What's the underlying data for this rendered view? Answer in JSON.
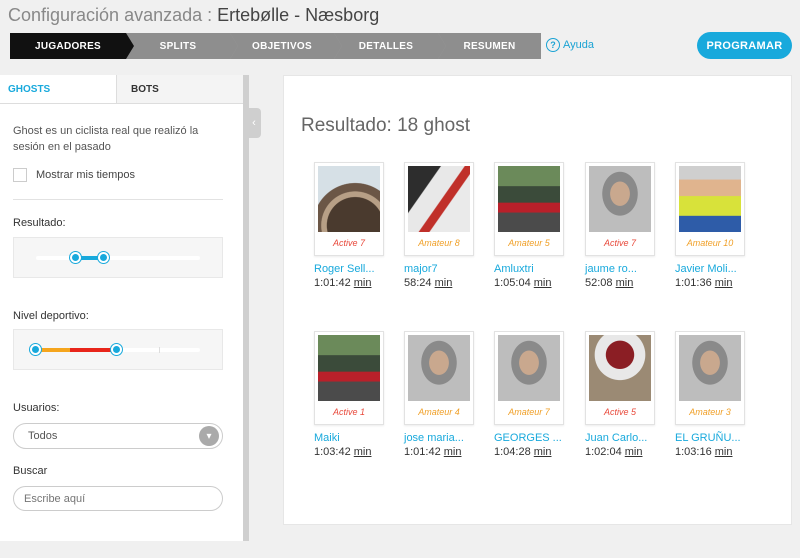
{
  "header": {
    "title_prefix": "Configuración avanzada :",
    "title_route": "Ertebølle - Næsborg"
  },
  "steps": [
    "JUGADORES",
    "SPLITS",
    "OBJETIVOS",
    "DETALLES",
    "RESUMEN"
  ],
  "active_step": "JUGADORES",
  "help_label": "Ayuda",
  "program_button": "PROGRAMAR",
  "sidebar": {
    "tabs": [
      "GHOSTS",
      "BOTS"
    ],
    "description": "Ghost es un ciclista real que realizó la sesión en el pasado",
    "show_my_times": "Mostrar mis tiempos",
    "result_label": "Resultado:",
    "level_label": "Nivel deportivo:",
    "users_label": "Usuarios:",
    "users_value": "Todos",
    "search_label": "Buscar",
    "search_placeholder": "Escribe aquí"
  },
  "results": {
    "title": "Resultado: 18 ghost",
    "ghosts": [
      {
        "level": "Active 7",
        "name": "Roger Sell...",
        "time": "1:01:42",
        "unit": "min",
        "kind": "active",
        "icon": "tire-photo"
      },
      {
        "level": "Amateur 8",
        "name": "major7",
        "time": "58:24",
        "unit": "min",
        "kind": "amateur",
        "icon": "bike-frame-photo"
      },
      {
        "level": "Amateur 5",
        "name": "Amluxtri",
        "time": "1:05:04",
        "unit": "min",
        "kind": "amateur",
        "icon": "cyclist-photo"
      },
      {
        "level": "Active 7",
        "name": "jaume ro...",
        "time": "52:08",
        "unit": "min",
        "kind": "active",
        "icon": "portrait-photo"
      },
      {
        "level": "Amateur 10",
        "name": "Javier Moli...",
        "time": "1:01:36",
        "unit": "min",
        "kind": "amateur",
        "icon": "rider-photo"
      },
      {
        "level": "Active 1",
        "name": "Maiki",
        "time": "1:03:42",
        "unit": "min",
        "kind": "active",
        "icon": "cyclist-photo"
      },
      {
        "level": "Amateur 4",
        "name": "jose maria...",
        "time": "1:01:42",
        "unit": "min",
        "kind": "amateur",
        "icon": "portrait-photo"
      },
      {
        "level": "Amateur 7",
        "name": "GEORGES ...",
        "time": "1:04:28",
        "unit": "min",
        "kind": "amateur",
        "icon": "portrait-photo"
      },
      {
        "level": "Active 5",
        "name": "Juan Carlo...",
        "time": "1:02:04",
        "unit": "min",
        "kind": "active",
        "icon": "helmet-photo"
      },
      {
        "level": "Amateur 3",
        "name": "EL GRUÑU...",
        "time": "1:03:16",
        "unit": "min",
        "kind": "amateur",
        "icon": "portrait-photo"
      }
    ]
  },
  "colors": {
    "accent": "#18a9dc",
    "active": "#e8483a",
    "amateur": "#f0a028",
    "step_active": "#111111",
    "step_inactive": "#8e8e8e"
  }
}
